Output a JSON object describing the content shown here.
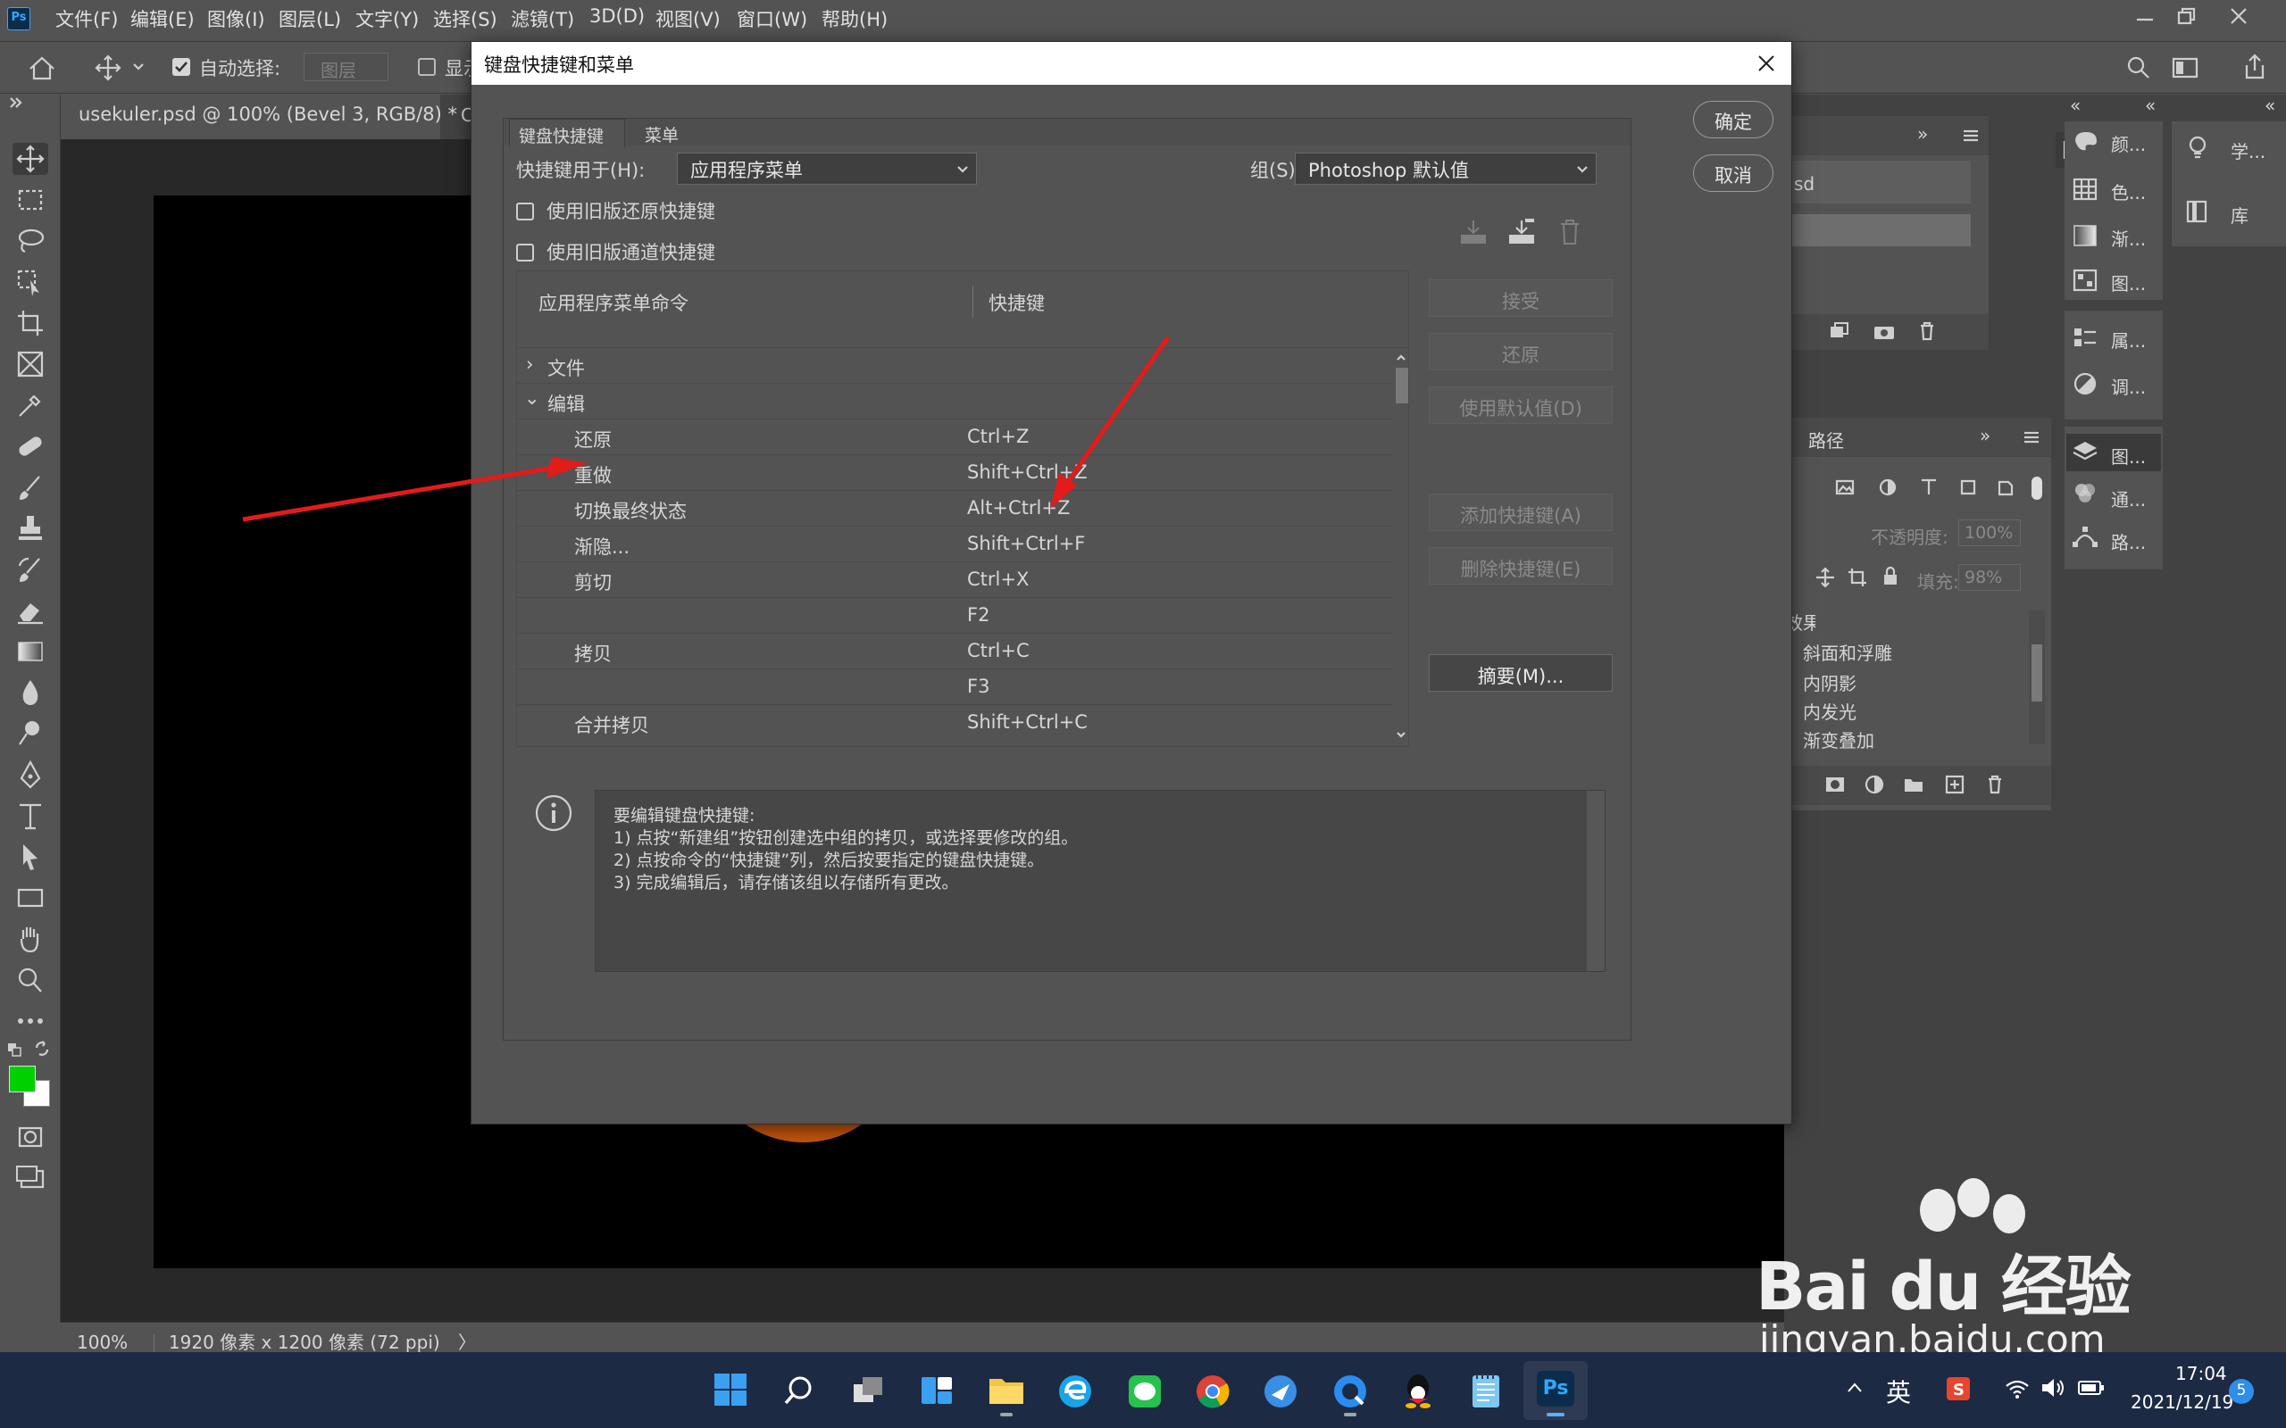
{
  "app": {
    "logo": "Ps"
  },
  "menubar": {
    "items": [
      "文件(F)",
      "编辑(E)",
      "图像(I)",
      "图层(L)",
      "文字(Y)",
      "选择(S)",
      "滤镜(T)",
      "3D(D)",
      "视图(V)",
      "窗口(W)",
      "帮助(H)"
    ]
  },
  "options_bar": {
    "auto_select_label": "自动选择:",
    "auto_select_value": "图层",
    "show_transform_label": "显示"
  },
  "document": {
    "tab_title": "usekuler.psd @ 100% (Bevel 3, RGB/8) *",
    "tab_close": "×",
    "second_tab_partial": "C",
    "zoom": "100%",
    "doc_info": "1920 像素 x 1200 像素 (72 ppi)",
    "status_arrow": "〉"
  },
  "swatches": {
    "foreground": "#00d000",
    "background": "#ffffff"
  },
  "right_panels": {
    "history_partial": "sd",
    "paths_tab": "路径",
    "opacity_label": "不透明度:",
    "opacity_value": "100%",
    "fill_label": "填充:",
    "fill_value": "98%",
    "effects_header": "效果",
    "effects": [
      "斜面和浮雕",
      "内阴影",
      "内发光",
      "渐变叠加"
    ],
    "dock1": [
      "颜...",
      "色...",
      "渐...",
      "图...",
      "属...",
      "调...",
      "图...",
      "通...",
      "路..."
    ],
    "dock2": [
      "学...",
      "库"
    ]
  },
  "dialog": {
    "title": "键盘快捷键和菜单",
    "close": "×",
    "ok": "确定",
    "cancel": "取消",
    "tabs": [
      "键盘快捷键",
      "菜单"
    ],
    "shortcuts_for_label": "快捷键用于(H):",
    "shortcuts_for_value": "应用程序菜单",
    "group_label": "组(S):",
    "group_value": "Photoshop 默认值",
    "legacy_undo": "使用旧版还原快捷键",
    "legacy_channel": "使用旧版通道快捷键",
    "col_command": "应用程序菜单命令",
    "col_shortcut": "快捷键",
    "rows": [
      {
        "cmd": "文件",
        "key": "",
        "type": "group",
        "arrow": "›"
      },
      {
        "cmd": "编辑",
        "key": "",
        "type": "group",
        "arrow": "⌄"
      },
      {
        "cmd": "还原",
        "key": "Ctrl+Z",
        "type": "item"
      },
      {
        "cmd": "重做",
        "key": "Shift+Ctrl+Z",
        "type": "item"
      },
      {
        "cmd": "切换最终状态",
        "key": "Alt+Ctrl+Z",
        "type": "item"
      },
      {
        "cmd": "渐隐...",
        "key": "Shift+Ctrl+F",
        "type": "item"
      },
      {
        "cmd": "剪切",
        "key": "Ctrl+X",
        "type": "item"
      },
      {
        "cmd": "",
        "key": "F2",
        "type": "item"
      },
      {
        "cmd": "拷贝",
        "key": "Ctrl+C",
        "type": "item"
      },
      {
        "cmd": "",
        "key": "F3",
        "type": "item"
      },
      {
        "cmd": "合并拷贝",
        "key": "Shift+Ctrl+C",
        "type": "item"
      }
    ],
    "side_buttons": {
      "accept": "接受",
      "undo": "还原",
      "use_default": "使用默认值(D)",
      "add_shortcut": "添加快捷键(A)",
      "delete_shortcut": "删除快捷键(E)",
      "summary": "摘要(M)..."
    },
    "info_lines": [
      "要编辑键盘快捷键:",
      "1) 点按“新建组”按钮创建选中组的拷贝，或选择要修改的组。",
      "2) 点按命令的“快捷键”列，然后按要指定的键盘快捷键。",
      "3) 完成编辑后，请存储该组以存储所有更改。"
    ]
  },
  "watermark": {
    "brand": "Bai du 经验",
    "url": "jingyan.baidu.com"
  },
  "taskbar": {
    "ime": "英",
    "time": "17:04",
    "date": "2021/12/19",
    "notif_count": "5",
    "active_app": "Ps"
  }
}
